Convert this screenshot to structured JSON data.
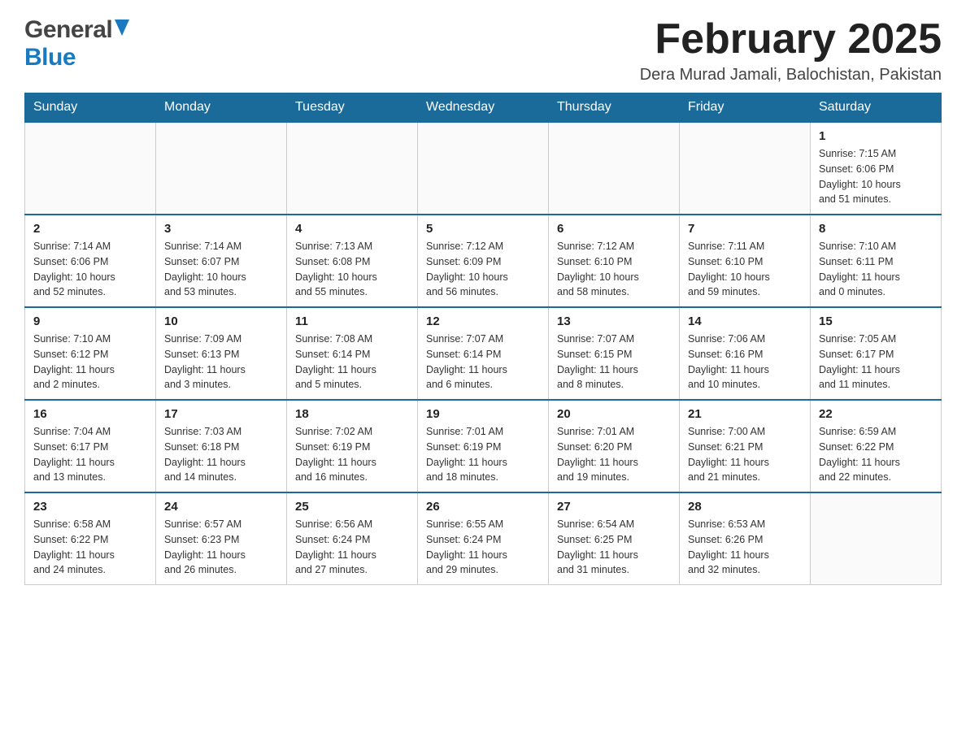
{
  "logo": {
    "general": "General",
    "blue": "Blue"
  },
  "header": {
    "month_title": "February 2025",
    "subtitle": "Dera Murad Jamali, Balochistan, Pakistan"
  },
  "days_of_week": [
    "Sunday",
    "Monday",
    "Tuesday",
    "Wednesday",
    "Thursday",
    "Friday",
    "Saturday"
  ],
  "weeks": [
    {
      "days": [
        {
          "number": "",
          "info": ""
        },
        {
          "number": "",
          "info": ""
        },
        {
          "number": "",
          "info": ""
        },
        {
          "number": "",
          "info": ""
        },
        {
          "number": "",
          "info": ""
        },
        {
          "number": "",
          "info": ""
        },
        {
          "number": "1",
          "info": "Sunrise: 7:15 AM\nSunset: 6:06 PM\nDaylight: 10 hours\nand 51 minutes."
        }
      ]
    },
    {
      "days": [
        {
          "number": "2",
          "info": "Sunrise: 7:14 AM\nSunset: 6:06 PM\nDaylight: 10 hours\nand 52 minutes."
        },
        {
          "number": "3",
          "info": "Sunrise: 7:14 AM\nSunset: 6:07 PM\nDaylight: 10 hours\nand 53 minutes."
        },
        {
          "number": "4",
          "info": "Sunrise: 7:13 AM\nSunset: 6:08 PM\nDaylight: 10 hours\nand 55 minutes."
        },
        {
          "number": "5",
          "info": "Sunrise: 7:12 AM\nSunset: 6:09 PM\nDaylight: 10 hours\nand 56 minutes."
        },
        {
          "number": "6",
          "info": "Sunrise: 7:12 AM\nSunset: 6:10 PM\nDaylight: 10 hours\nand 58 minutes."
        },
        {
          "number": "7",
          "info": "Sunrise: 7:11 AM\nSunset: 6:10 PM\nDaylight: 10 hours\nand 59 minutes."
        },
        {
          "number": "8",
          "info": "Sunrise: 7:10 AM\nSunset: 6:11 PM\nDaylight: 11 hours\nand 0 minutes."
        }
      ]
    },
    {
      "days": [
        {
          "number": "9",
          "info": "Sunrise: 7:10 AM\nSunset: 6:12 PM\nDaylight: 11 hours\nand 2 minutes."
        },
        {
          "number": "10",
          "info": "Sunrise: 7:09 AM\nSunset: 6:13 PM\nDaylight: 11 hours\nand 3 minutes."
        },
        {
          "number": "11",
          "info": "Sunrise: 7:08 AM\nSunset: 6:14 PM\nDaylight: 11 hours\nand 5 minutes."
        },
        {
          "number": "12",
          "info": "Sunrise: 7:07 AM\nSunset: 6:14 PM\nDaylight: 11 hours\nand 6 minutes."
        },
        {
          "number": "13",
          "info": "Sunrise: 7:07 AM\nSunset: 6:15 PM\nDaylight: 11 hours\nand 8 minutes."
        },
        {
          "number": "14",
          "info": "Sunrise: 7:06 AM\nSunset: 6:16 PM\nDaylight: 11 hours\nand 10 minutes."
        },
        {
          "number": "15",
          "info": "Sunrise: 7:05 AM\nSunset: 6:17 PM\nDaylight: 11 hours\nand 11 minutes."
        }
      ]
    },
    {
      "days": [
        {
          "number": "16",
          "info": "Sunrise: 7:04 AM\nSunset: 6:17 PM\nDaylight: 11 hours\nand 13 minutes."
        },
        {
          "number": "17",
          "info": "Sunrise: 7:03 AM\nSunset: 6:18 PM\nDaylight: 11 hours\nand 14 minutes."
        },
        {
          "number": "18",
          "info": "Sunrise: 7:02 AM\nSunset: 6:19 PM\nDaylight: 11 hours\nand 16 minutes."
        },
        {
          "number": "19",
          "info": "Sunrise: 7:01 AM\nSunset: 6:19 PM\nDaylight: 11 hours\nand 18 minutes."
        },
        {
          "number": "20",
          "info": "Sunrise: 7:01 AM\nSunset: 6:20 PM\nDaylight: 11 hours\nand 19 minutes."
        },
        {
          "number": "21",
          "info": "Sunrise: 7:00 AM\nSunset: 6:21 PM\nDaylight: 11 hours\nand 21 minutes."
        },
        {
          "number": "22",
          "info": "Sunrise: 6:59 AM\nSunset: 6:22 PM\nDaylight: 11 hours\nand 22 minutes."
        }
      ]
    },
    {
      "days": [
        {
          "number": "23",
          "info": "Sunrise: 6:58 AM\nSunset: 6:22 PM\nDaylight: 11 hours\nand 24 minutes."
        },
        {
          "number": "24",
          "info": "Sunrise: 6:57 AM\nSunset: 6:23 PM\nDaylight: 11 hours\nand 26 minutes."
        },
        {
          "number": "25",
          "info": "Sunrise: 6:56 AM\nSunset: 6:24 PM\nDaylight: 11 hours\nand 27 minutes."
        },
        {
          "number": "26",
          "info": "Sunrise: 6:55 AM\nSunset: 6:24 PM\nDaylight: 11 hours\nand 29 minutes."
        },
        {
          "number": "27",
          "info": "Sunrise: 6:54 AM\nSunset: 6:25 PM\nDaylight: 11 hours\nand 31 minutes."
        },
        {
          "number": "28",
          "info": "Sunrise: 6:53 AM\nSunset: 6:26 PM\nDaylight: 11 hours\nand 32 minutes."
        },
        {
          "number": "",
          "info": ""
        }
      ]
    }
  ]
}
